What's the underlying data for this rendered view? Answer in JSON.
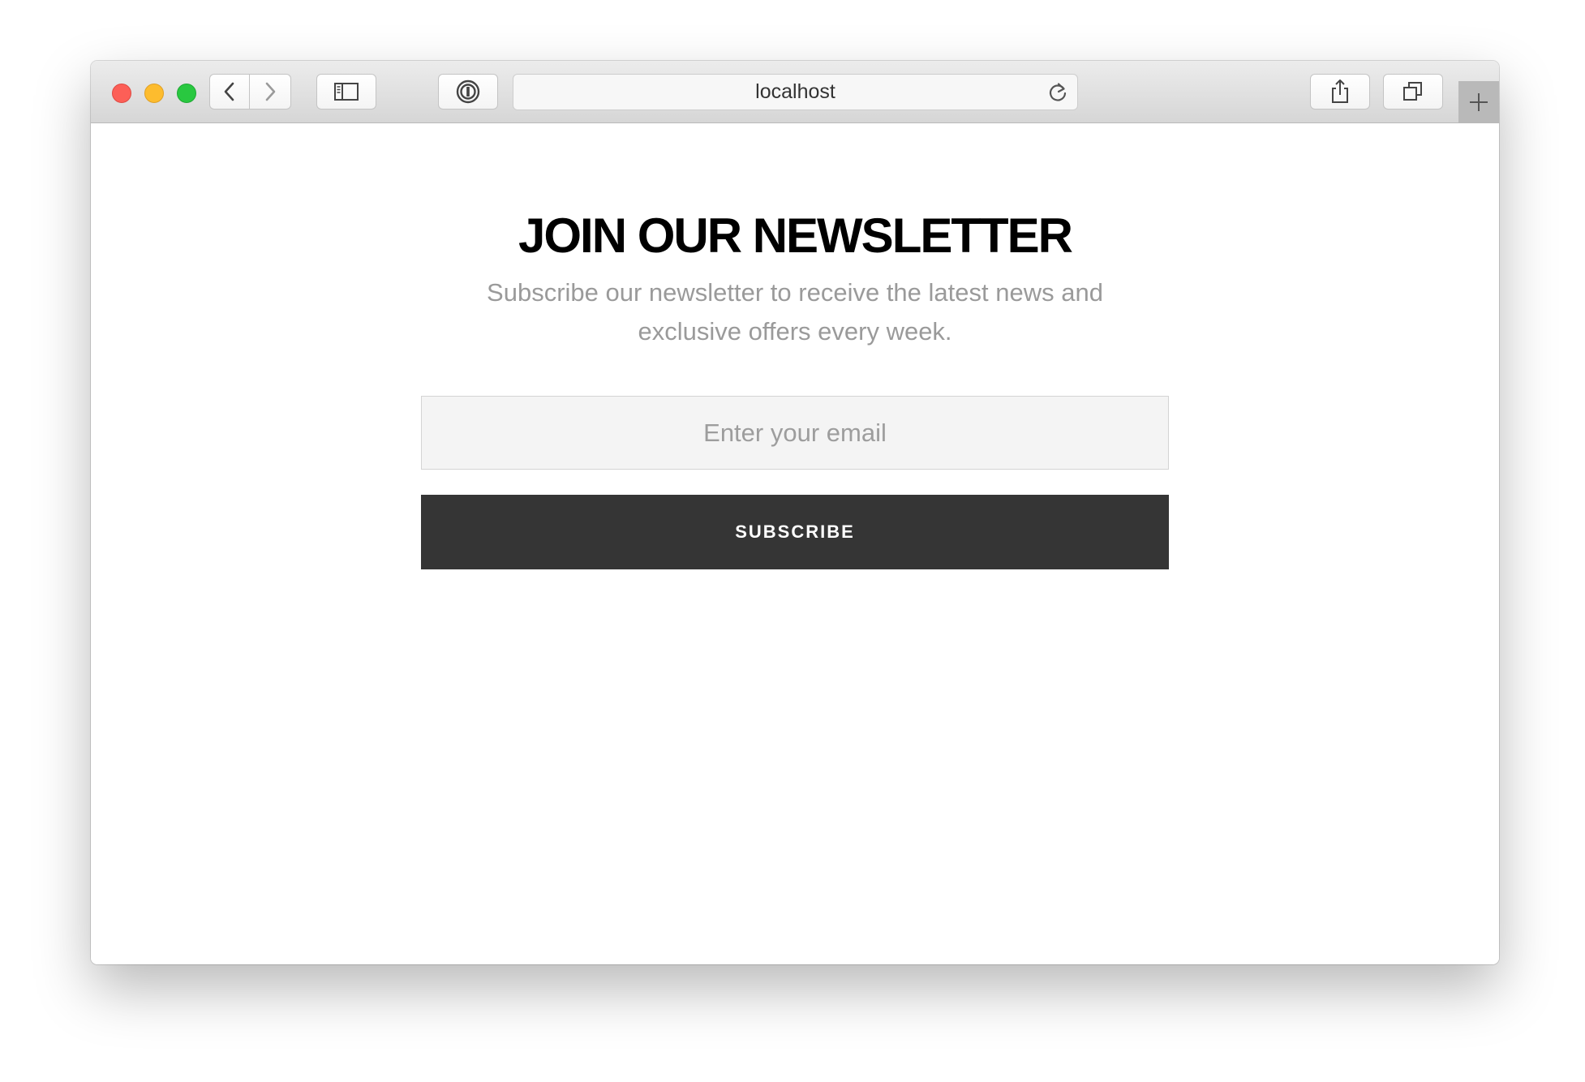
{
  "browser": {
    "address": "localhost",
    "icons": {
      "back": "chevron-left-icon",
      "forward": "chevron-right-icon",
      "sidebar": "sidebar-icon",
      "password_manager": "password-manager-icon",
      "reload": "reload-icon",
      "share": "share-icon",
      "tabs": "tabs-overview-icon",
      "new_tab": "plus-icon"
    },
    "traffic_colors": {
      "close": "#fc5f57",
      "minimize": "#fdbc2e",
      "zoom": "#29c840"
    }
  },
  "newsletter": {
    "title": "JOIN OUR NEWSLETTER",
    "subtitle": "Subscribe our newsletter to receive the latest news and exclusive offers every week.",
    "email_placeholder": "Enter your email",
    "email_value": "",
    "subscribe_label": "SUBSCRIBE",
    "button_color": "#353535"
  }
}
